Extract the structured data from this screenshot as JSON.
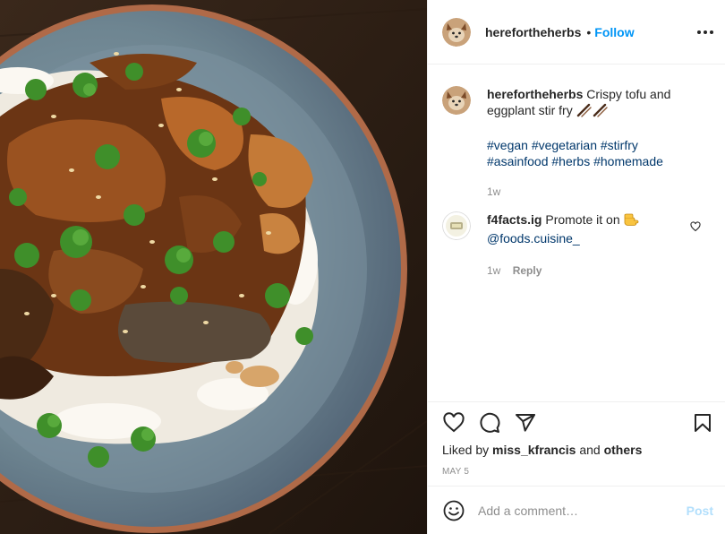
{
  "post": {
    "author": "herefortheherbs",
    "separator": "•",
    "follow_label": "Follow",
    "more_options_icon": "more-horizontal-icon"
  },
  "caption": {
    "author": "herefortheherbs",
    "text": "Crispy tofu and eggplant stir fry",
    "emoji": "chopsticks-emoji",
    "hashtags": "#vegan #vegetarian #stirfry #asainfood #herbs #homemade",
    "time": "1w"
  },
  "comments": [
    {
      "author": "f4facts.ig",
      "text": "Promote it on",
      "emoji": "pointing-hand-emoji",
      "mention": "@foods.cuisine_",
      "time": "1w",
      "reply_label": "Reply"
    }
  ],
  "actions": {
    "like_icon": "heart-icon",
    "comment_icon": "comment-icon",
    "share_icon": "share-icon",
    "save_icon": "bookmark-icon",
    "liked_by_prefix": "Liked by",
    "liked_by_user": "miss_kfrancis",
    "liked_by_and": "and",
    "liked_by_others": "others",
    "date": "MAY 5"
  },
  "add_comment": {
    "placeholder": "Add a comment…",
    "post_label": "Post",
    "emoji_icon": "smiley-icon"
  },
  "colors": {
    "follow_blue": "#0095f6",
    "post_disabled": "#b2dffc",
    "hashtag": "#00376b",
    "muted": "#8e8e8e"
  }
}
